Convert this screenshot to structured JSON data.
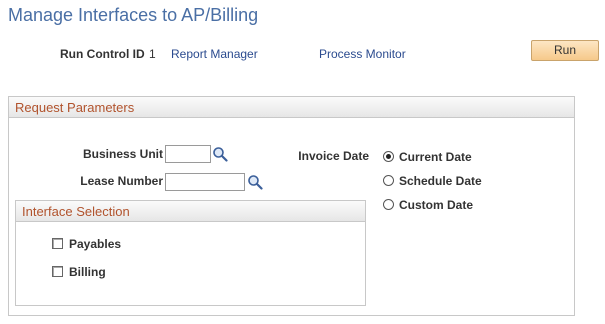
{
  "page": {
    "title": "Manage Interfaces to AP/Billing"
  },
  "run_control": {
    "label": "Run Control ID",
    "value": "1",
    "report_manager": "Report Manager",
    "process_monitor": "Process Monitor",
    "run_button": "Run"
  },
  "request_parameters": {
    "title": "Request Parameters",
    "business_unit": {
      "label": "Business Unit",
      "value": "",
      "icon": "magnifier-lookup-icon"
    },
    "lease_number": {
      "label": "Lease Number",
      "value": "",
      "icon": "magnifier-lookup-icon"
    },
    "invoice_date": {
      "label": "Invoice Date",
      "options": [
        {
          "label": "Current Date",
          "selected": true
        },
        {
          "label": "Schedule Date",
          "selected": false
        },
        {
          "label": "Custom Date",
          "selected": false
        }
      ]
    },
    "interface_selection": {
      "title": "Interface Selection",
      "options": [
        {
          "label": "Payables",
          "checked": false
        },
        {
          "label": "Billing",
          "checked": false
        }
      ]
    }
  },
  "colors": {
    "title": "#4a6fa5",
    "link": "#2b4b8f",
    "group_title": "#b1532d",
    "run_button": "#f6c98a"
  }
}
